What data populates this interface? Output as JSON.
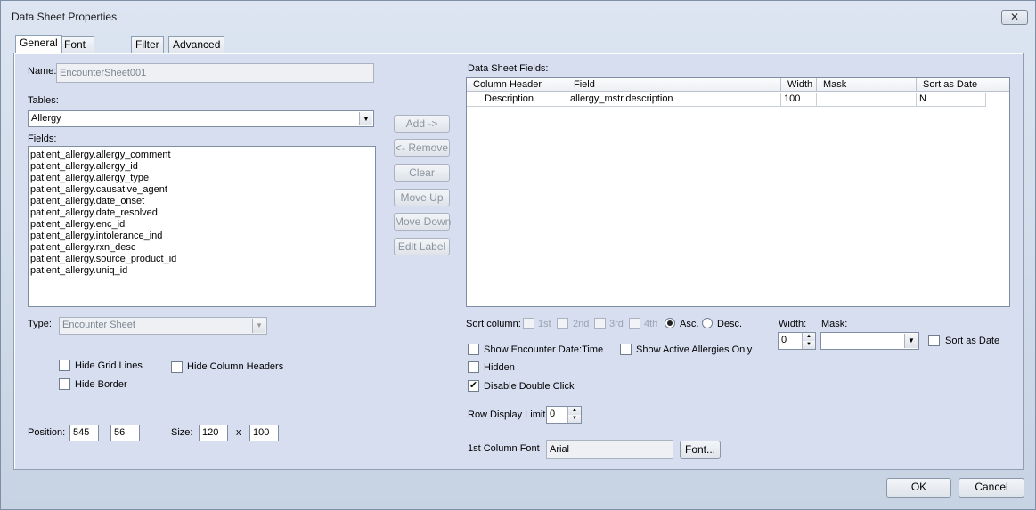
{
  "window": {
    "title": "Data Sheet Properties",
    "close_glyph": "✕"
  },
  "tabs": [
    "General",
    "Font and Color",
    "Filter",
    "Advanced"
  ],
  "general": {
    "name_label": "Name:",
    "name_value": "EncounterSheet001",
    "tables_label": "Tables:",
    "tables_value": "Allergy",
    "fields_label": "Fields:",
    "fields": [
      "patient_allergy.allergy_comment",
      "patient_allergy.allergy_id",
      "patient_allergy.allergy_type",
      "patient_allergy.causative_agent",
      "patient_allergy.date_onset",
      "patient_allergy.date_resolved",
      "patient_allergy.enc_id",
      "patient_allergy.intolerance_ind",
      "patient_allergy.rxn_desc",
      "patient_allergy.source_product_id",
      "patient_allergy.uniq_id"
    ],
    "type_label": "Type:",
    "type_value": "Encounter Sheet",
    "hide_grid_lines": "Hide Grid Lines",
    "hide_column_headers": "Hide Column Headers",
    "hide_border": "Hide Border",
    "position_label": "Position:",
    "position_x": "545",
    "position_y": "56",
    "size_label": "Size:",
    "size_w": "120",
    "size_x": "x",
    "size_h": "100"
  },
  "actions": {
    "add": "Add ->",
    "remove": "<- Remove",
    "clear": "Clear",
    "move_up": "Move Up",
    "move_down": "Move Down",
    "edit_label": "Edit Label"
  },
  "datasheet": {
    "label": "Data Sheet Fields:",
    "columns": [
      "Column Header",
      "Field",
      "Width",
      "Mask",
      "Sort as Date"
    ],
    "rows": [
      {
        "column_header": "Description",
        "field": "allergy_mstr.description",
        "width": "100",
        "mask": "",
        "sort_as_date": "N"
      }
    ]
  },
  "sort": {
    "label": "Sort column:",
    "options": [
      "1st",
      "2nd",
      "3rd",
      "4th"
    ],
    "asc": "Asc.",
    "desc": "Desc."
  },
  "width_label": "Width:",
  "width_value": "0",
  "mask_label": "Mask:",
  "mask_value": "",
  "sort_as_date": "Sort as Date",
  "options": {
    "show_encounter_date_time": "Show Encounter Date:Time",
    "show_active_allergies_only": "Show Active Allergies Only",
    "hidden": "Hidden",
    "disable_double_click": "Disable Double Click",
    "disable_double_click_checked": true
  },
  "row_display_limit_label": "Row Display Limit:",
  "row_display_limit_value": "0",
  "first_col_font_label": "1st Column Font",
  "first_col_font_value": "Arial",
  "font_button": "Font...",
  "ok_button": "OK",
  "cancel_button": "Cancel",
  "check_glyph": "✔"
}
